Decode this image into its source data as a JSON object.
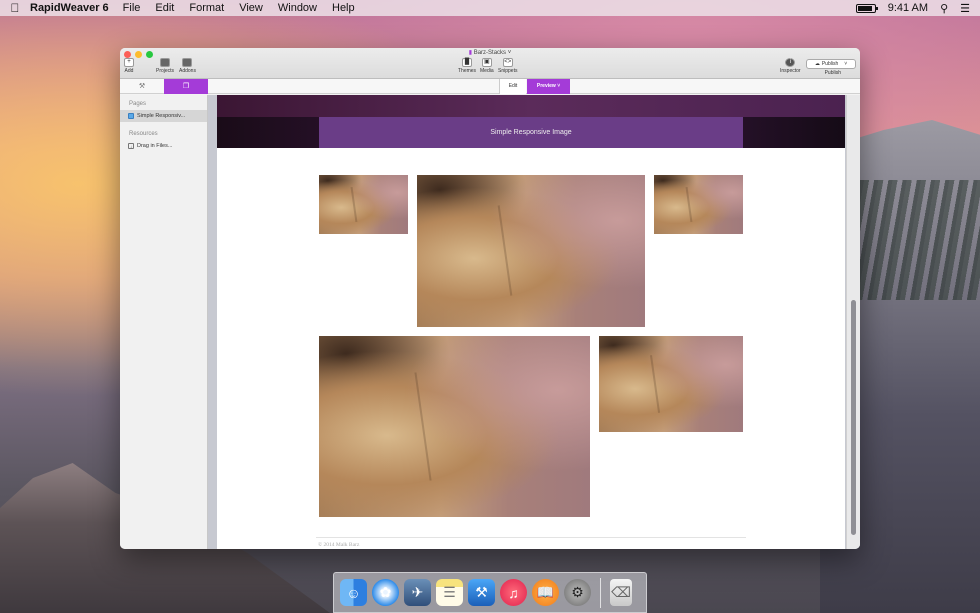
{
  "menubar": {
    "app_name": "RapidWeaver 6",
    "menus": [
      "File",
      "Edit",
      "Format",
      "View",
      "Window",
      "Help"
    ],
    "time": "9:41 AM",
    "battery_level": 0.9
  },
  "window": {
    "title": "Barz-Stacks",
    "toolbar": {
      "add": "Add",
      "projects": "Projects",
      "addons": "Addons",
      "themes": "Themes",
      "media": "Media",
      "snippets": "Snippets",
      "inspector": "Inspector",
      "publish_button": "Publish",
      "publish_label": "Publish"
    },
    "tabs": {
      "edit": "Edit",
      "preview": "Preview"
    },
    "accent_color": "#a43bd8"
  },
  "sidebar": {
    "pages_header": "Pages",
    "page_item": "Simple Responsiv...",
    "resources_header": "Resources",
    "resource_item": "Drag in Files..."
  },
  "preview_page": {
    "banner_title": "Simple Responsive Image",
    "footer": "© 2014 Malk Barz"
  },
  "dock": {
    "icons": [
      "finder-icon",
      "safari-icon",
      "preview-icon",
      "notes-icon",
      "xcode-icon",
      "itunes-icon",
      "ibooks-icon",
      "system-preferences-icon",
      "trash-icon"
    ]
  }
}
